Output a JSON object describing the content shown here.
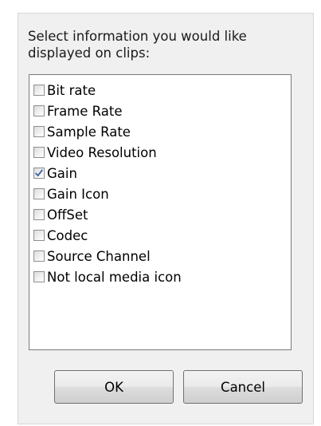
{
  "dialog": {
    "prompt": "Select information you would like displayed on clips:",
    "options": [
      {
        "label": "Bit rate",
        "checked": false
      },
      {
        "label": "Frame Rate",
        "checked": false
      },
      {
        "label": "Sample Rate",
        "checked": false
      },
      {
        "label": "Video Resolution",
        "checked": false
      },
      {
        "label": "Gain",
        "checked": true
      },
      {
        "label": "Gain Icon",
        "checked": false
      },
      {
        "label": "OffSet",
        "checked": false
      },
      {
        "label": "Codec",
        "checked": false
      },
      {
        "label": "Source Channel",
        "checked": false
      },
      {
        "label": "Not local media icon",
        "checked": false
      }
    ],
    "ok_label": "OK",
    "cancel_label": "Cancel"
  },
  "colors": {
    "dialog_bg": "#f0f0f0",
    "check_mark": "#3c5fa8"
  }
}
